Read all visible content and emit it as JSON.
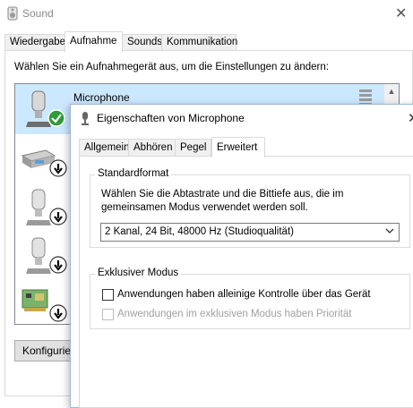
{
  "sound_window": {
    "title": "Sound",
    "close_glyph": "✕",
    "tabs": [
      {
        "label": "Wiedergabe",
        "active": false
      },
      {
        "label": "Aufnahme",
        "active": true
      },
      {
        "label": "Sounds",
        "active": false
      },
      {
        "label": "Kommunikation",
        "active": false
      }
    ],
    "instruction": "Wählen Sie ein Aufnahmegerät aus, um die Einstellungen zu ändern:",
    "devices": [
      {
        "name": "Microphone",
        "icon": "microphone-icon",
        "status": "default-check",
        "selected": true
      },
      {
        "name": "",
        "icon": "line-in-device-icon",
        "status": "disabled-arrow",
        "selected": false
      },
      {
        "name": "",
        "icon": "microphone-icon",
        "status": "disabled-arrow",
        "selected": false
      },
      {
        "name": "",
        "icon": "microphone-icon",
        "status": "disabled-arrow",
        "selected": false
      },
      {
        "name": "",
        "icon": "sound-card-icon",
        "status": "disabled-arrow",
        "selected": false
      }
    ],
    "configure_button": "Konfigurie"
  },
  "properties_dialog": {
    "title": "Eigenschaften von Microphone",
    "close_glyph": "✕",
    "tabs": [
      {
        "label": "Allgemein",
        "active": false
      },
      {
        "label": "Abhören",
        "active": false
      },
      {
        "label": "Pegel",
        "active": false
      },
      {
        "label": "Erweitert",
        "active": true
      }
    ],
    "standard_format": {
      "group_label": "Standardformat",
      "description_line1": "Wählen Sie die Abtastrate und die Bittiefe aus, die im",
      "description_line2": "gemeinsamen Modus verwendet werden soll.",
      "selected_format": "2 Kanal, 24 Bit, 48000 Hz (Studioqualität)"
    },
    "exclusive_mode": {
      "group_label": "Exklusiver Modus",
      "allow_exclusive_label": "Anwendungen haben alleinige Kontrolle über das Gerät",
      "allow_exclusive_checked": false,
      "priority_label": "Anwendungen im exklusiven Modus haben Priorität",
      "priority_checked": false,
      "priority_enabled": false
    }
  },
  "colors": {
    "selection": "#cce8ff",
    "check_green": "#2e9b3a",
    "tab_border": "#d9d9d9"
  }
}
